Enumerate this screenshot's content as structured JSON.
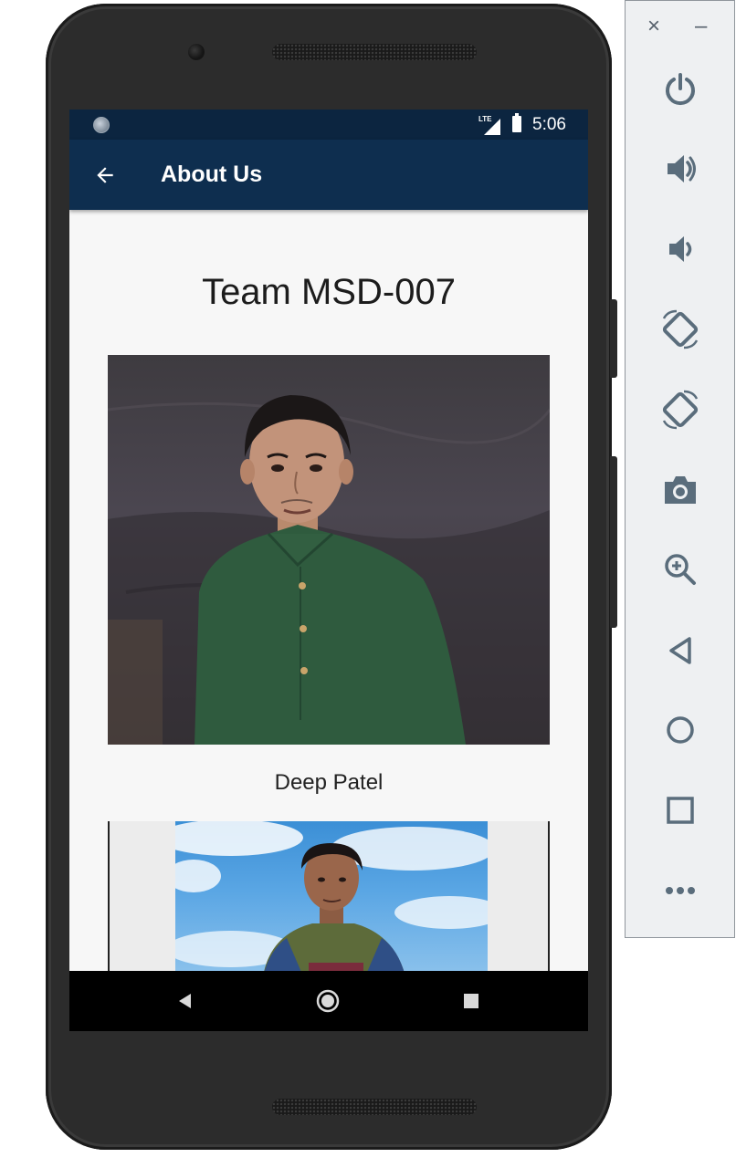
{
  "emulator": {
    "close_symbol": "×",
    "minimize_symbol": "–",
    "controls": [
      {
        "name": "power-icon"
      },
      {
        "name": "volume-up-icon"
      },
      {
        "name": "volume-down-icon"
      },
      {
        "name": "rotate-left-icon"
      },
      {
        "name": "rotate-right-icon"
      },
      {
        "name": "camera-icon"
      },
      {
        "name": "zoom-icon"
      },
      {
        "name": "back-icon"
      },
      {
        "name": "home-icon"
      },
      {
        "name": "overview-icon"
      },
      {
        "name": "more-icon"
      }
    ],
    "icon_color": "#5a6d7c"
  },
  "status_bar": {
    "network": "LTE",
    "time": "5:06"
  },
  "app_bar": {
    "title": "About Us",
    "color": "#0e2e4f"
  },
  "content": {
    "team_title": "Team MSD-007",
    "members": [
      {
        "name": "Deep Patel"
      }
    ]
  },
  "nav_bar": {
    "icons": [
      "nav-back-icon",
      "nav-home-icon",
      "nav-recents-icon"
    ]
  }
}
